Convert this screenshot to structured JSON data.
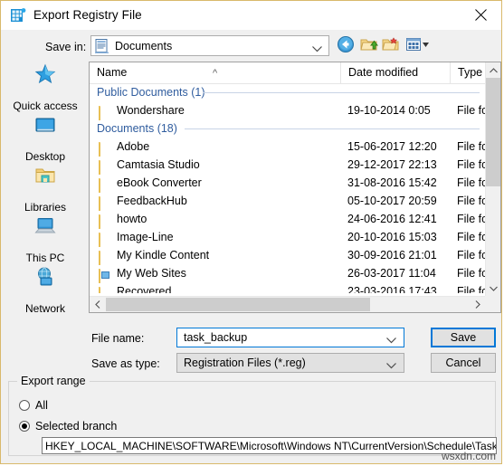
{
  "window": {
    "title": "Export Registry File",
    "icon": "registry-icon",
    "close_label": "×"
  },
  "toolbar": {
    "save_in_label": "Save in:",
    "save_in_value": "Documents",
    "buttons": [
      {
        "name": "back-button",
        "icon": "back-arrow-icon"
      },
      {
        "name": "up-one-level-button",
        "icon": "up-folder-icon"
      },
      {
        "name": "new-folder-button",
        "icon": "new-folder-icon"
      },
      {
        "name": "views-button",
        "icon": "views-icon"
      }
    ]
  },
  "places": [
    {
      "label": "Quick access",
      "icon": "star-icon"
    },
    {
      "label": "Desktop",
      "icon": "monitor-icon"
    },
    {
      "label": "Libraries",
      "icon": "libraries-folder-icon"
    },
    {
      "label": "This PC",
      "icon": "computer-icon"
    },
    {
      "label": "Network",
      "icon": "network-globe-icon"
    }
  ],
  "filelist": {
    "columns": [
      "Name",
      "Date modified",
      "Type"
    ],
    "sort_indicator": "^",
    "groups": [
      {
        "header": "Public Documents (1)",
        "items": [
          {
            "name": "Wondershare",
            "date": "19-10-2014 0:05",
            "type": "File fol",
            "icon": "folder-icon"
          }
        ]
      },
      {
        "header": "Documents (18)",
        "items": [
          {
            "name": "Adobe",
            "date": "15-06-2017 12:20",
            "type": "File fol",
            "icon": "folder-icon"
          },
          {
            "name": "Camtasia Studio",
            "date": "29-12-2017 22:13",
            "type": "File fol",
            "icon": "folder-icon"
          },
          {
            "name": "eBook Converter",
            "date": "31-08-2016 15:42",
            "type": "File fol",
            "icon": "folder-icon"
          },
          {
            "name": "FeedbackHub",
            "date": "05-10-2017 20:59",
            "type": "File fol",
            "icon": "folder-icon"
          },
          {
            "name": "howto",
            "date": "24-06-2016 12:41",
            "type": "File fol",
            "icon": "folder-icon"
          },
          {
            "name": "Image-Line",
            "date": "20-10-2016 15:03",
            "type": "File fol",
            "icon": "folder-icon"
          },
          {
            "name": "My Kindle Content",
            "date": "30-09-2016 21:01",
            "type": "File fol",
            "icon": "folder-icon"
          },
          {
            "name": "My Web Sites",
            "date": "26-03-2017 11:04",
            "type": "File fol",
            "icon": "web-folder-icon"
          },
          {
            "name": "Recovered",
            "date": "23-03-2016 17:43",
            "type": "File fol",
            "icon": "folder-icon"
          }
        ]
      }
    ]
  },
  "form": {
    "file_name_label": "File name:",
    "file_name_value": "task_backup",
    "save_as_type_label": "Save as type:",
    "save_as_type_value": "Registration Files (*.reg)",
    "save_button": "Save",
    "cancel_button": "Cancel"
  },
  "export_range": {
    "group_title": "Export range",
    "option_all": "All",
    "option_selected_branch": "Selected branch",
    "selected_option": "Selected branch",
    "branch_path": "HKEY_LOCAL_MACHINE\\SOFTWARE\\Microsoft\\Windows NT\\CurrentVersion\\Schedule\\TaskCache"
  },
  "watermark": "wsxdn.com",
  "colors": {
    "dialog_border": "#d9b96b",
    "focus_blue": "#0078d7",
    "group_header_text": "#2f5c9e",
    "folder_yellow": "#fcd97c"
  }
}
